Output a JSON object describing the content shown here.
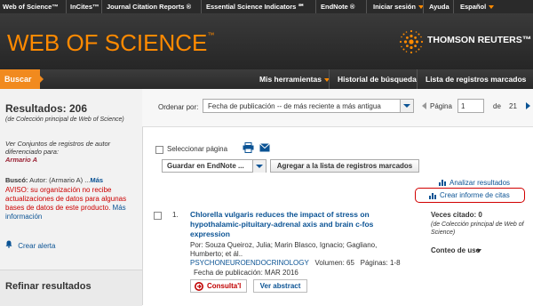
{
  "topbar": {
    "links": [
      "Web of Science™",
      "InCites™",
      "Journal Citation Reports ®",
      "Essential Science Indicators ℠",
      "EndNote ®"
    ],
    "signin": "Iniciar sesión",
    "help": "Ayuda",
    "language": "Español"
  },
  "header": {
    "logo_text": "WEB OF SCIENCE",
    "logo_tm": "™",
    "publisher": "THOMSON REUTERS™"
  },
  "nav": {
    "search": "Buscar",
    "tools": "Mis herramientas",
    "history": "Historial de búsqueda",
    "marked": "Lista de registros marcados"
  },
  "results": {
    "count_label": "Resultados: 206",
    "source": "(de Colección principal de Web of Science)",
    "author_sets_text": "Ver Conjuntos de registros de autor diferenciado para:",
    "author_name": "Armario A",
    "searched_label": "Buscó:",
    "searched_value": "Autor: (Armario A)  ...",
    "searched_more": "Más",
    "warning": "AVISO: su organización no recibe actualizaciones de datos para algunas bases de datos de este producto.",
    "more_info": "Más información",
    "create_alert": "Crear alerta",
    "refine": "Refinar resultados"
  },
  "sort": {
    "label": "Ordenar por:",
    "value": "Fecha de publicación -- de más reciente a más antigua"
  },
  "pager": {
    "page_label": "Página",
    "current": "1",
    "of": "de",
    "total": "21"
  },
  "toolbar": {
    "select_page": "Seleccionar página",
    "save_endnote": "Guardar en EndNote ...",
    "add_to_list": "Agregar a la lista de registros marcados",
    "analyze": "Analizar resultados",
    "citation_report": "Crear informe de citas"
  },
  "record": {
    "number": "1.",
    "title": "Chlorella vulgaris reduces the impact of stress on hypothalamic-pituitary-adrenal axis and brain c-fos expression",
    "authors": "Por: Souza Queiroz, Julia; Marin Blasco, Ignacio; Gagliano, Humberto; et ál..",
    "journal": "PSYCHONEUROENDOCRINOLOGY",
    "volume": "Volumen: 65",
    "pages": "Páginas: 1-8",
    "date": "Fecha de publicación: MAR 2016",
    "consult_button": "Consulta'l",
    "abstract_button": "Ver abstract",
    "times_cited": "Veces citado: 0",
    "times_cited_source": "(de Colección principal de Web of Science)",
    "usage_count": "Conteo de uso"
  },
  "colors": {
    "accent_orange": "#f18a1e",
    "link_blue": "#0b5394",
    "warning_red": "#cc0000",
    "header_dark": "#2a2a2a"
  }
}
